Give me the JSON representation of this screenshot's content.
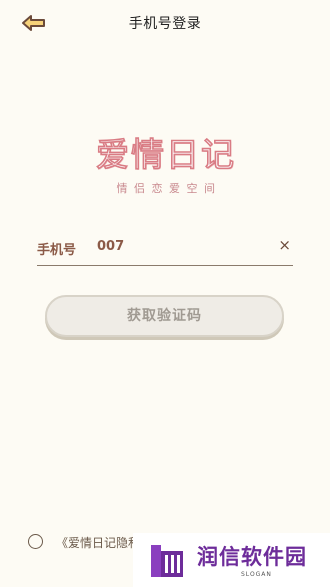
{
  "header": {
    "title": "手机号登录",
    "back_icon": "back-arrow-icon"
  },
  "logo": {
    "title": "爱情日记",
    "subtitle": "情侣恋爱空间"
  },
  "phone": {
    "label": "手机号",
    "value": "007",
    "clear_icon": "×"
  },
  "code_button": {
    "label": "获取验证码"
  },
  "agreement": {
    "text": "《爱情日记隐私"
  },
  "watermark": {
    "name": "润信软件园",
    "slogan": "SLOGAN"
  },
  "colors": {
    "background": "#fdfbf4",
    "accent": "#8b5a47",
    "logo": "#d97c84",
    "watermark": "#6d2c9a"
  }
}
